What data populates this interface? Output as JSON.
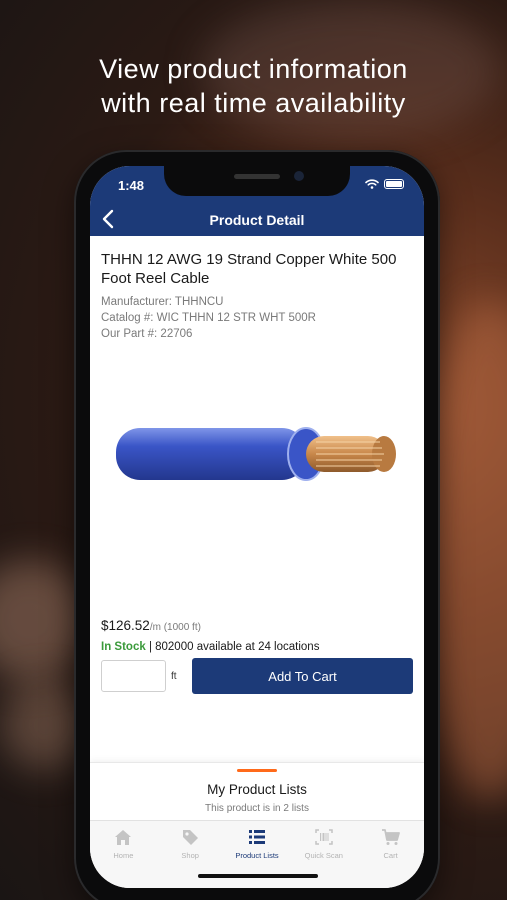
{
  "headline": {
    "line1": "View product information",
    "line2": "with real time availability"
  },
  "status_bar": {
    "time": "1:48",
    "icons": [
      "wifi-icon",
      "battery-icon"
    ]
  },
  "nav": {
    "title": "Product Detail",
    "back_icon": "chevron-left-icon"
  },
  "product": {
    "title": "THHN 12 AWG 19 Strand Copper White 500 Foot Reel Cable",
    "manufacturer": "Manufacturer: THHNCU",
    "catalog": "Catalog #: WIC THHN 12 STR WHT 500R",
    "part": "Our Part #: 22706",
    "price": "$126.52",
    "price_unit": "/m (1000 ft)",
    "stock_status": "In Stock",
    "availability": "| 802000 available at 24 locations",
    "quantity_value": "",
    "quantity_unit": "ft",
    "add_to_cart_label": "Add To Cart"
  },
  "product_lists": {
    "title": "My Product Lists",
    "subtitle": "This product is in 2 lists"
  },
  "tabs": [
    {
      "label": "Home",
      "icon": "home-icon",
      "active": false
    },
    {
      "label": "Shop",
      "icon": "tag-icon",
      "active": false
    },
    {
      "label": "Product Lists",
      "icon": "list-icon",
      "active": true
    },
    {
      "label": "Quick Scan",
      "icon": "barcode-scan-icon",
      "active": false
    },
    {
      "label": "Cart",
      "icon": "cart-icon",
      "active": false
    }
  ],
  "colors": {
    "brand": "#1c3a78",
    "in_stock": "#3a9a3a",
    "accent": "#ff6a1a"
  }
}
